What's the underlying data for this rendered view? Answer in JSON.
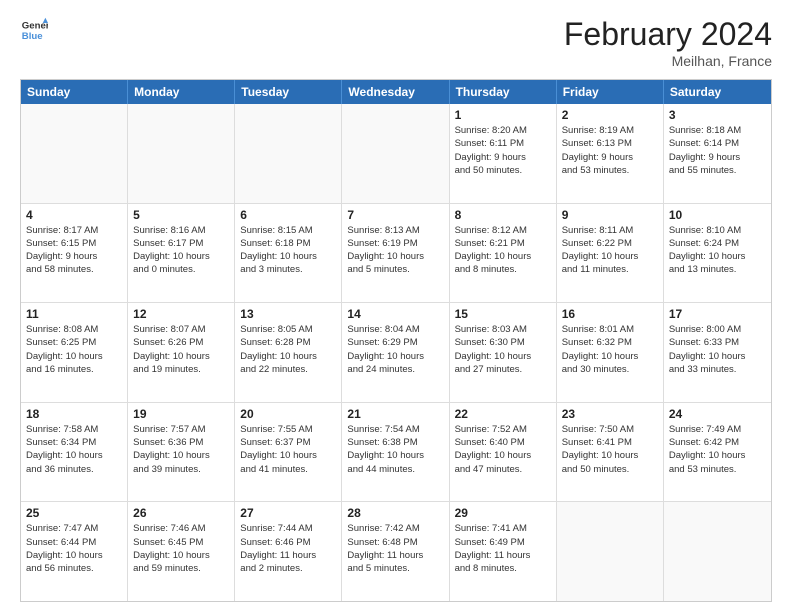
{
  "header": {
    "logo_line1": "General",
    "logo_line2": "Blue",
    "title": "February 2024",
    "location": "Meilhan, France"
  },
  "days_of_week": [
    "Sunday",
    "Monday",
    "Tuesday",
    "Wednesday",
    "Thursday",
    "Friday",
    "Saturday"
  ],
  "weeks": [
    [
      {
        "day": "",
        "info": ""
      },
      {
        "day": "",
        "info": ""
      },
      {
        "day": "",
        "info": ""
      },
      {
        "day": "",
        "info": ""
      },
      {
        "day": "1",
        "info": "Sunrise: 8:20 AM\nSunset: 6:11 PM\nDaylight: 9 hours\nand 50 minutes."
      },
      {
        "day": "2",
        "info": "Sunrise: 8:19 AM\nSunset: 6:13 PM\nDaylight: 9 hours\nand 53 minutes."
      },
      {
        "day": "3",
        "info": "Sunrise: 8:18 AM\nSunset: 6:14 PM\nDaylight: 9 hours\nand 55 minutes."
      }
    ],
    [
      {
        "day": "4",
        "info": "Sunrise: 8:17 AM\nSunset: 6:15 PM\nDaylight: 9 hours\nand 58 minutes."
      },
      {
        "day": "5",
        "info": "Sunrise: 8:16 AM\nSunset: 6:17 PM\nDaylight: 10 hours\nand 0 minutes."
      },
      {
        "day": "6",
        "info": "Sunrise: 8:15 AM\nSunset: 6:18 PM\nDaylight: 10 hours\nand 3 minutes."
      },
      {
        "day": "7",
        "info": "Sunrise: 8:13 AM\nSunset: 6:19 PM\nDaylight: 10 hours\nand 5 minutes."
      },
      {
        "day": "8",
        "info": "Sunrise: 8:12 AM\nSunset: 6:21 PM\nDaylight: 10 hours\nand 8 minutes."
      },
      {
        "day": "9",
        "info": "Sunrise: 8:11 AM\nSunset: 6:22 PM\nDaylight: 10 hours\nand 11 minutes."
      },
      {
        "day": "10",
        "info": "Sunrise: 8:10 AM\nSunset: 6:24 PM\nDaylight: 10 hours\nand 13 minutes."
      }
    ],
    [
      {
        "day": "11",
        "info": "Sunrise: 8:08 AM\nSunset: 6:25 PM\nDaylight: 10 hours\nand 16 minutes."
      },
      {
        "day": "12",
        "info": "Sunrise: 8:07 AM\nSunset: 6:26 PM\nDaylight: 10 hours\nand 19 minutes."
      },
      {
        "day": "13",
        "info": "Sunrise: 8:05 AM\nSunset: 6:28 PM\nDaylight: 10 hours\nand 22 minutes."
      },
      {
        "day": "14",
        "info": "Sunrise: 8:04 AM\nSunset: 6:29 PM\nDaylight: 10 hours\nand 24 minutes."
      },
      {
        "day": "15",
        "info": "Sunrise: 8:03 AM\nSunset: 6:30 PM\nDaylight: 10 hours\nand 27 minutes."
      },
      {
        "day": "16",
        "info": "Sunrise: 8:01 AM\nSunset: 6:32 PM\nDaylight: 10 hours\nand 30 minutes."
      },
      {
        "day": "17",
        "info": "Sunrise: 8:00 AM\nSunset: 6:33 PM\nDaylight: 10 hours\nand 33 minutes."
      }
    ],
    [
      {
        "day": "18",
        "info": "Sunrise: 7:58 AM\nSunset: 6:34 PM\nDaylight: 10 hours\nand 36 minutes."
      },
      {
        "day": "19",
        "info": "Sunrise: 7:57 AM\nSunset: 6:36 PM\nDaylight: 10 hours\nand 39 minutes."
      },
      {
        "day": "20",
        "info": "Sunrise: 7:55 AM\nSunset: 6:37 PM\nDaylight: 10 hours\nand 41 minutes."
      },
      {
        "day": "21",
        "info": "Sunrise: 7:54 AM\nSunset: 6:38 PM\nDaylight: 10 hours\nand 44 minutes."
      },
      {
        "day": "22",
        "info": "Sunrise: 7:52 AM\nSunset: 6:40 PM\nDaylight: 10 hours\nand 47 minutes."
      },
      {
        "day": "23",
        "info": "Sunrise: 7:50 AM\nSunset: 6:41 PM\nDaylight: 10 hours\nand 50 minutes."
      },
      {
        "day": "24",
        "info": "Sunrise: 7:49 AM\nSunset: 6:42 PM\nDaylight: 10 hours\nand 53 minutes."
      }
    ],
    [
      {
        "day": "25",
        "info": "Sunrise: 7:47 AM\nSunset: 6:44 PM\nDaylight: 10 hours\nand 56 minutes."
      },
      {
        "day": "26",
        "info": "Sunrise: 7:46 AM\nSunset: 6:45 PM\nDaylight: 10 hours\nand 59 minutes."
      },
      {
        "day": "27",
        "info": "Sunrise: 7:44 AM\nSunset: 6:46 PM\nDaylight: 11 hours\nand 2 minutes."
      },
      {
        "day": "28",
        "info": "Sunrise: 7:42 AM\nSunset: 6:48 PM\nDaylight: 11 hours\nand 5 minutes."
      },
      {
        "day": "29",
        "info": "Sunrise: 7:41 AM\nSunset: 6:49 PM\nDaylight: 11 hours\nand 8 minutes."
      },
      {
        "day": "",
        "info": ""
      },
      {
        "day": "",
        "info": ""
      }
    ]
  ]
}
